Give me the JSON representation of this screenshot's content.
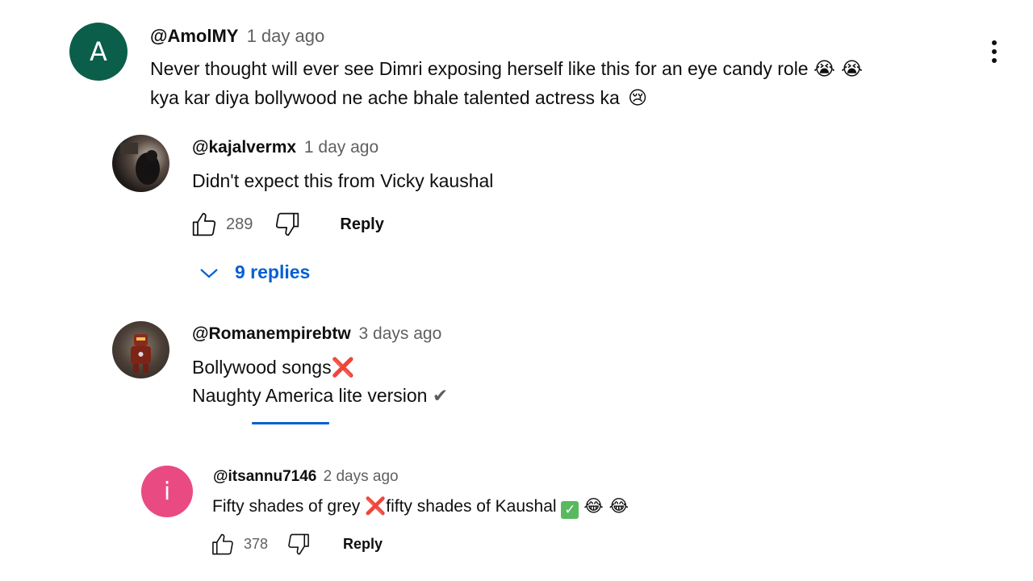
{
  "comment_main": {
    "avatar_letter": "A",
    "handle": "@AmolMY",
    "time": "1 day ago",
    "line1": "Never thought will ever see Dimri exposing herself like this for an  eye candy role",
    "line1_emoji": "😭 😭",
    "line2": "kya kar diya bollywood ne ache bhale talented actress ka",
    "line2_emoji": "😢"
  },
  "reply_1": {
    "handle": "@kajalvermx",
    "time": "1 day ago",
    "text": "Didn't expect this from Vicky kaushal",
    "likes": "289",
    "reply_label": "Reply",
    "replies_toggle": "9 replies"
  },
  "reply_2": {
    "handle": "@Romanempirebtw",
    "time": "3 days ago",
    "line1": "Bollywood songs",
    "line1_mark": "❌",
    "line2": "Naughty America lite version",
    "line2_mark": "✔"
  },
  "reply_3": {
    "avatar_letter": "i",
    "handle": "@itsannu7146",
    "time": "2 days ago",
    "text_a": "Fifty shades of grey",
    "mark_a": "❌",
    "text_b": "fifty shades of Kaushal",
    "mark_b": "✓",
    "emoji": "😂 😂",
    "likes": "378",
    "reply_label": "Reply"
  },
  "colors": {
    "avatar_a": "#0b5e4a",
    "avatar_i": "#e94a82",
    "link_blue": "#065fd4",
    "meta_gray": "#606060"
  },
  "icons": [
    "thumb-up-icon",
    "thumb-down-icon",
    "chevron-down-icon",
    "more-vert-icon"
  ]
}
